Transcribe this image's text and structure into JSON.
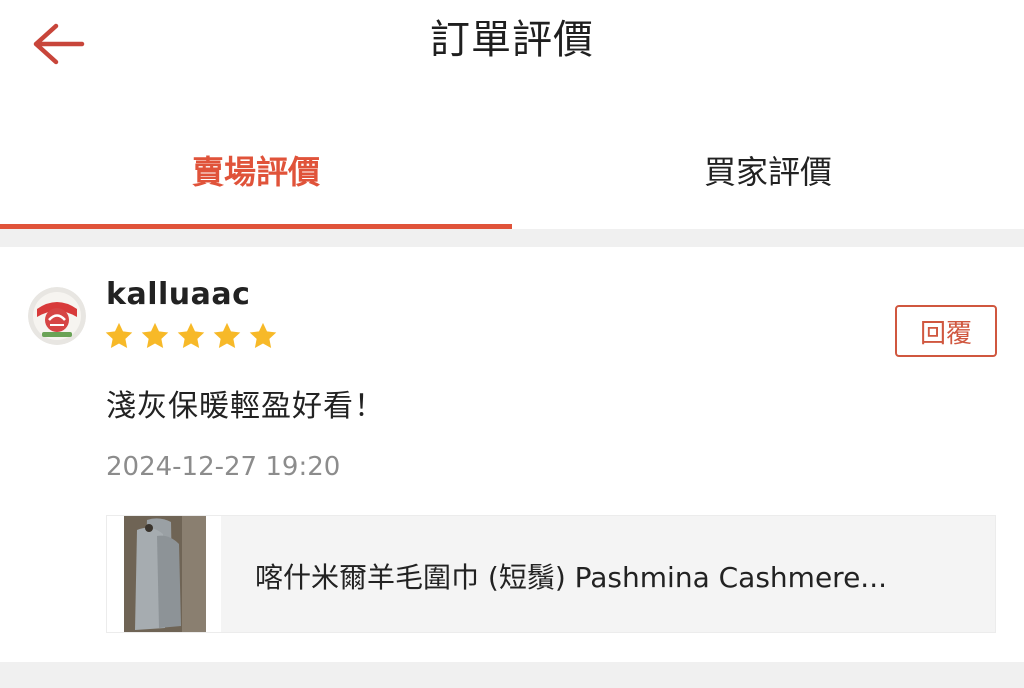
{
  "header": {
    "back_icon": "arrow-left-icon",
    "title": "訂單評價"
  },
  "tabs": [
    {
      "label": "賣場評價",
      "active": true
    },
    {
      "label": "買家評價",
      "active": false
    }
  ],
  "colors": {
    "accent": "#e0533a",
    "star": "#f7b928",
    "timestamp": "#8c8c8c",
    "divider": "#f0f0f0"
  },
  "review": {
    "username": "kalluaac",
    "rating": 5,
    "max_rating": 5,
    "reply_label": "回覆",
    "comment": "淺灰保暖輕盈好看！",
    "timestamp": "2024-12-27 19:20",
    "product": {
      "name": "喀什米爾羊毛圍巾 (短鬚) Pashmina Cashmere..."
    }
  }
}
